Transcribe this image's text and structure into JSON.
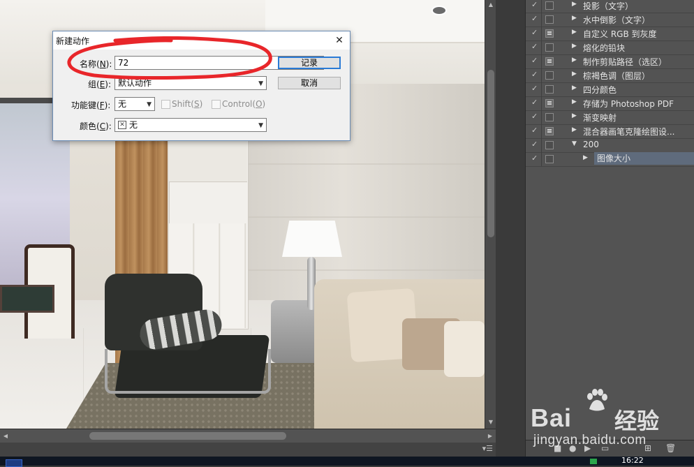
{
  "dialog": {
    "title": "新建动作",
    "name_label": "名称(",
    "name_key": "N",
    "name_label_end": "):",
    "name_value": "72",
    "group_label": "组(",
    "group_key": "E",
    "group_label_end": "):",
    "group_value": "默认动作",
    "function_key_label": "功能键(",
    "function_key_key": "F",
    "function_key_label_end": "):",
    "function_key_value": "无",
    "shift_label": "Shift(",
    "shift_key": "S",
    "shift_label_end": ")",
    "control_label": "Control(",
    "control_key": "O",
    "control_label_end": ")",
    "color_label": "颜色(",
    "color_key": "C",
    "color_label_end": "):",
    "color_value": "无",
    "record_button": "记录",
    "cancel_button": "取消",
    "close_glyph": "✕"
  },
  "actions_panel": {
    "items": [
      {
        "label": "投影（文字）",
        "checked": true,
        "dialog": false,
        "expanded": false,
        "level": 1
      },
      {
        "label": "水中倒影（文字）",
        "checked": true,
        "dialog": false,
        "expanded": false,
        "level": 1
      },
      {
        "label": "自定义 RGB 到灰度",
        "checked": true,
        "dialog": true,
        "expanded": false,
        "level": 1
      },
      {
        "label": "熔化的铅块",
        "checked": true,
        "dialog": false,
        "expanded": false,
        "level": 1
      },
      {
        "label": "制作剪贴路径（选区）",
        "checked": true,
        "dialog": true,
        "expanded": false,
        "level": 1
      },
      {
        "label": "棕褐色调（图层）",
        "checked": true,
        "dialog": false,
        "expanded": false,
        "level": 1
      },
      {
        "label": "四分颜色",
        "checked": true,
        "dialog": false,
        "expanded": false,
        "level": 1
      },
      {
        "label": "存储为 Photoshop PDF",
        "checked": true,
        "dialog": true,
        "expanded": false,
        "level": 1
      },
      {
        "label": "渐变映射",
        "checked": true,
        "dialog": false,
        "expanded": false,
        "level": 1
      },
      {
        "label": "混合器画笔克隆绘图设...",
        "checked": true,
        "dialog": true,
        "expanded": false,
        "level": 1
      },
      {
        "label": "200",
        "checked": true,
        "dialog": false,
        "expanded": true,
        "level": 0
      },
      {
        "label": "图像大小",
        "checked": true,
        "dialog": false,
        "expanded": false,
        "level": 2,
        "selected": true
      }
    ]
  },
  "watermark": {
    "brand": "Bai",
    "brand2": "经验",
    "url": "jingyan.baidu.com"
  },
  "taskbar": {
    "clock": "16:22"
  },
  "colors": {
    "annotation": "#e8262a",
    "panel_bg": "#535353",
    "selected_row": "#5f6b7c",
    "default_button_border": "#2a7bd6"
  }
}
